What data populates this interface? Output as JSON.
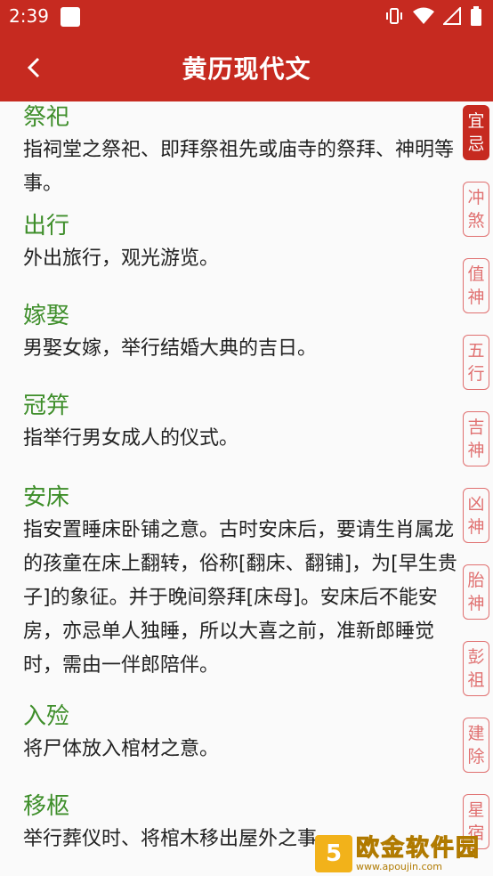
{
  "status_bar": {
    "time": "2:39"
  },
  "app_bar": {
    "title": "黄历现代文"
  },
  "entries": [
    {
      "name": "祭祀",
      "desc": "指祠堂之祭祀、即拜祭祖先或庙寺的祭拜、神明等事。"
    },
    {
      "name": "出行",
      "desc": "外出旅行，观光游览。"
    },
    {
      "name": "嫁娶",
      "desc": "男娶女嫁，举行结婚大典的吉日。"
    },
    {
      "name": "冠笄",
      "desc": "指举行男女成人的仪式。"
    },
    {
      "name": "安床",
      "desc": "指安置睡床卧铺之意。古时安床后，要请生肖属龙的孩童在床上翻转，俗称[翻床、翻铺]，为[早生贵子]的象征。并于晚间祭拜[床母]。安床后不能安房，亦忌单人独睡，所以大喜之前，准新郎睡觉时，需由一伴郎陪伴。"
    },
    {
      "name": "入殓",
      "desc": "将尸体放入棺材之意。"
    },
    {
      "name": "移柩",
      "desc": "举行葬仪时、将棺木移出屋外之事。"
    }
  ],
  "sidebar_tabs": [
    {
      "top": "宜",
      "bottom": "忌"
    },
    {
      "top": "冲",
      "bottom": "煞"
    },
    {
      "top": "值",
      "bottom": "神"
    },
    {
      "top": "五",
      "bottom": "行"
    },
    {
      "top": "吉",
      "bottom": "神"
    },
    {
      "top": "凶",
      "bottom": "神"
    },
    {
      "top": "胎",
      "bottom": "神"
    },
    {
      "top": "彭",
      "bottom": "祖"
    },
    {
      "top": "建",
      "bottom": "除"
    },
    {
      "top": "星",
      "bottom": "宿"
    }
  ],
  "watermark": {
    "logo": "5",
    "brand": "欧金软件园",
    "url": "www.apoujin.com"
  }
}
